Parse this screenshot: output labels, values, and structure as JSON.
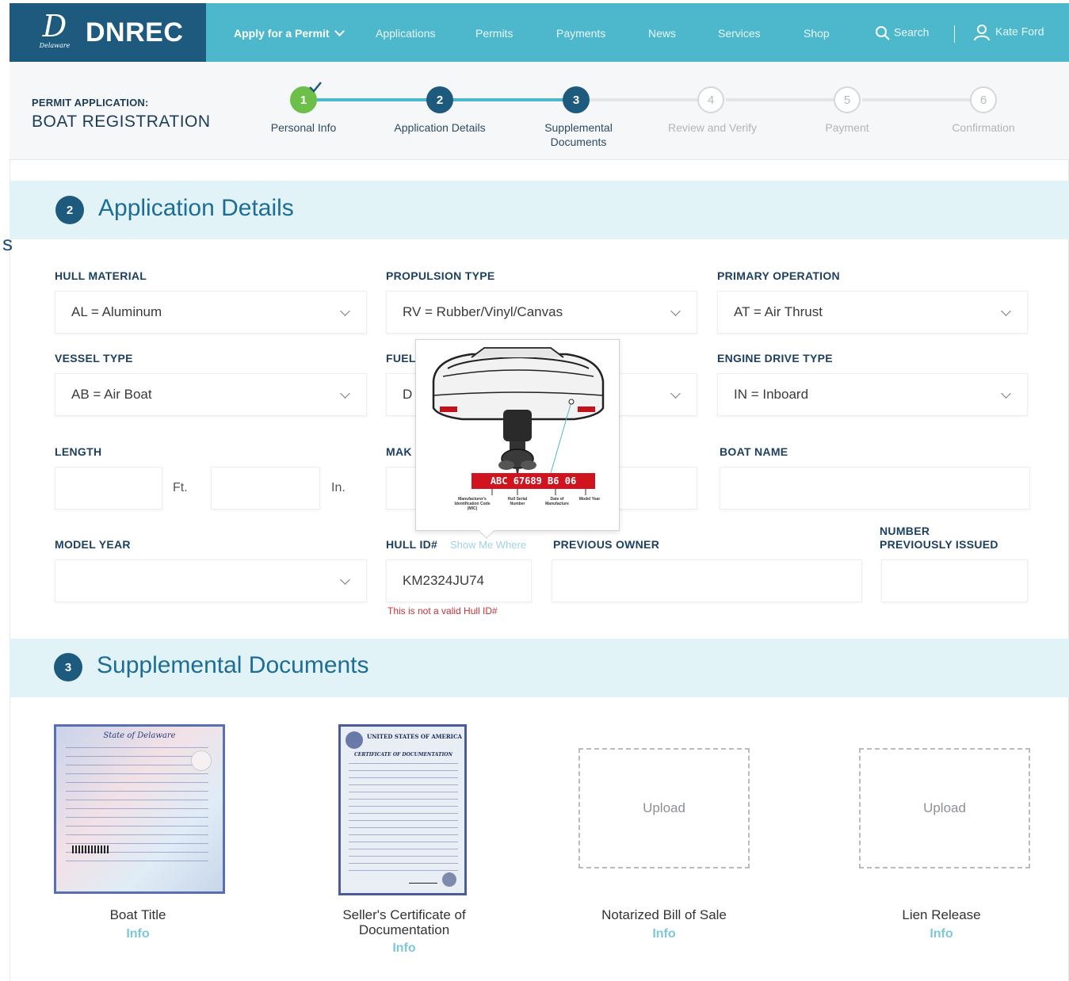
{
  "brand": {
    "name": "DNREC",
    "seal_script": "D",
    "seal_state": "Delaware"
  },
  "nav": {
    "items": [
      "Apply for a Permit",
      "Applications",
      "Permits",
      "Payments",
      "News",
      "Services",
      "Shop"
    ],
    "search_label": "Search",
    "user_name": "Kate Ford"
  },
  "permit": {
    "label": "PERMIT APPLICATION:",
    "title": "BOAT REGISTRATION"
  },
  "steps": [
    {
      "num": "1",
      "label": "Personal Info",
      "state": "done"
    },
    {
      "num": "2",
      "label": "Application Details",
      "state": "active"
    },
    {
      "num": "3",
      "label": "Supplemental Documents",
      "state": "active"
    },
    {
      "num": "4",
      "label": "Review and Verify",
      "state": "todo"
    },
    {
      "num": "5",
      "label": "Payment",
      "state": "todo"
    },
    {
      "num": "6",
      "label": "Confirmation",
      "state": "todo"
    }
  ],
  "stray_char": "s",
  "section2": {
    "num": "2",
    "title": "Application Details"
  },
  "form": {
    "hull_material": {
      "label": "HULL MATERIAL",
      "value": "AL = Aluminum"
    },
    "propulsion_type": {
      "label": "PROPULSION TYPE",
      "value": "RV = Rubber/Vinyl/Canvas"
    },
    "primary_operation": {
      "label": "PRIMARY OPERATION",
      "value": "AT = Air Thrust"
    },
    "vessel_type": {
      "label": "VESSEL TYPE",
      "value": "AB = Air Boat"
    },
    "fuel_type": {
      "label": "FUEL",
      "value": "D"
    },
    "engine_drive_type": {
      "label": "ENGINE DRIVE TYPE",
      "value": "IN = Inboard"
    },
    "length": {
      "label": "LENGTH",
      "ft_unit": "Ft.",
      "in_unit": "In."
    },
    "make": {
      "label": "MAK"
    },
    "boat_name": {
      "label": "BOAT NAME"
    },
    "model_year": {
      "label": "MODEL YEAR",
      "value": ""
    },
    "hull_id": {
      "label": "HULL ID#",
      "hint": "Show Me Where",
      "value": "KM2324JU74",
      "error": "This is not a valid Hull ID#"
    },
    "previous_owner": {
      "label": "PREVIOUS OWNER"
    },
    "number_previously_issued": {
      "label_line1": "NUMBER",
      "label_line2": "PREVIOUSLY ISSUED"
    }
  },
  "popup": {
    "hin_plate": "ABC 67689 B6 06",
    "captions": [
      "Manufacturer's Identification Code (MIC)",
      "Hull Serial Number",
      "Date of Manufacture",
      "Model Year"
    ]
  },
  "section3": {
    "num": "3",
    "title": "Supplemental Documents"
  },
  "documents": [
    {
      "label": "Boat Title",
      "info": "Info",
      "type": "image",
      "doc_heading": "State of Delaware"
    },
    {
      "label": "Seller's Certificate of Documentation",
      "info": "Info",
      "type": "image",
      "doc_heading": "UNITED STATES OF AMERICA",
      "doc_sub": "CERTIFICATE OF DOCUMENTATION"
    },
    {
      "label": "Notarized Bill of Sale",
      "info": "Info",
      "type": "upload",
      "upload_label": "Upload"
    },
    {
      "label": "Lien Release",
      "info": "Info",
      "type": "upload",
      "upload_label": "Upload"
    }
  ],
  "colors": {
    "nav": "#4db8cc",
    "brand": "#1d5a7e",
    "done": "#6cc04a",
    "section_bg": "#e2f3f7",
    "error": "#c4323a"
  }
}
